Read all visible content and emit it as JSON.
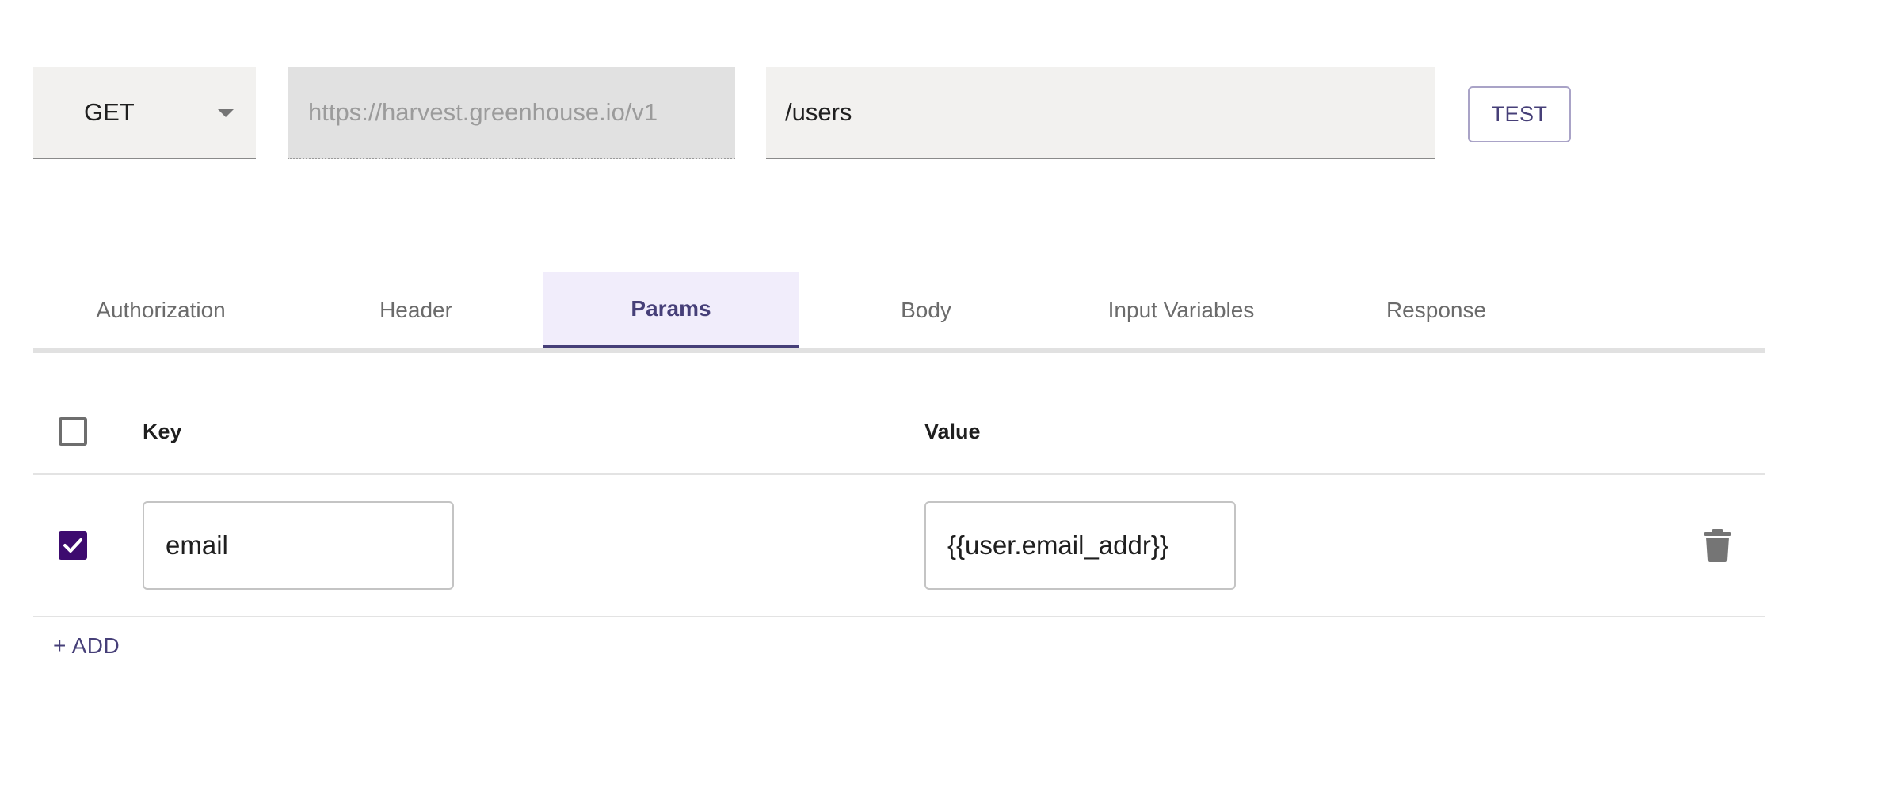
{
  "request": {
    "method": "GET",
    "base_url": "https://harvest.greenhouse.io/v1",
    "path": "/users",
    "test_label": "TEST"
  },
  "tabs": [
    {
      "label": "Authorization",
      "active": false
    },
    {
      "label": "Header",
      "active": false
    },
    {
      "label": "Params",
      "active": true
    },
    {
      "label": "Body",
      "active": false
    },
    {
      "label": "Input Variables",
      "active": false
    },
    {
      "label": "Response",
      "active": false
    }
  ],
  "params": {
    "header": {
      "key_label": "Key",
      "value_label": "Value",
      "select_all_checked": false
    },
    "rows": [
      {
        "enabled": true,
        "key": "email",
        "value": "{{user.email_addr}}"
      }
    ],
    "add_label": "+ ADD"
  },
  "colors": {
    "accent": "#463f78",
    "checkbox_checked": "#3d0b6f",
    "active_tab_bg": "#f1edfb",
    "field_bg": "#f2f1ef",
    "disabled_field_bg": "#e1e1e1"
  },
  "icons": {
    "method_dropdown": "chevron-down-icon",
    "row_delete": "trash-icon",
    "checkmark": "check-icon"
  }
}
